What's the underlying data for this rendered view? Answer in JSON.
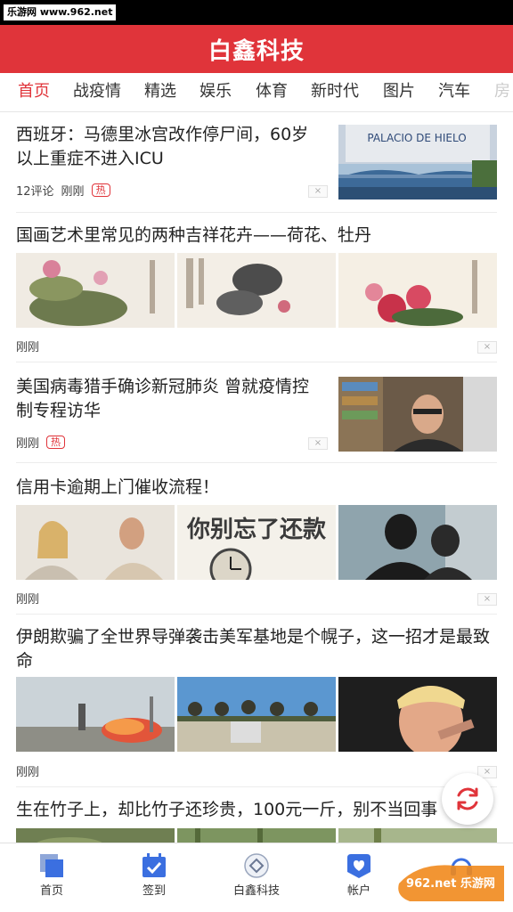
{
  "status": {
    "watermark": "乐游网 www.962.net"
  },
  "header": {
    "title": "白鑫科技"
  },
  "tabs": [
    {
      "label": "首页"
    },
    {
      "label": "战疫情"
    },
    {
      "label": "精选"
    },
    {
      "label": "娱乐"
    },
    {
      "label": "体育"
    },
    {
      "label": "新时代"
    },
    {
      "label": "图片"
    },
    {
      "label": "汽车"
    },
    {
      "label": "房"
    }
  ],
  "articles": [
    {
      "title": "西班牙：马德里冰宫改作停尸间，60岁以上重症不进入ICU",
      "comments": "12评论",
      "time": "刚刚",
      "badge": "热",
      "image_text": "PALACIO DE HIELO"
    },
    {
      "title": "国画艺术里常见的两种吉祥花卉——荷花、牡丹",
      "time": "刚刚"
    },
    {
      "title": "美国病毒猎手确诊新冠肺炎 曾就疫情控制专程访华",
      "time": "刚刚",
      "badge": "热"
    },
    {
      "title": "信用卡逾期上门催收流程！",
      "time": "刚刚",
      "image_text": "你别忘了还款"
    },
    {
      "title": "伊朗欺骗了全世界导弹袭击美军基地是个幌子，这一招才是最致命",
      "time": "刚刚"
    },
    {
      "title": "生在竹子上，却比竹子还珍贵，100元一斤，别不当回事"
    }
  ],
  "close_glyph": "×",
  "bottom_nav": [
    {
      "label": "首页",
      "icon": "home-icon"
    },
    {
      "label": "签到",
      "icon": "calendar-check-icon"
    },
    {
      "label": "白鑫科技",
      "icon": "app-logo-icon"
    },
    {
      "label": "帐户",
      "icon": "account-icon"
    },
    {
      "label": "",
      "icon": "headset-icon"
    }
  ],
  "watermark_corner": "962.net 乐游网",
  "colors": {
    "brand_red": "#e0343a",
    "nav_blue": "#3b6fe0"
  }
}
